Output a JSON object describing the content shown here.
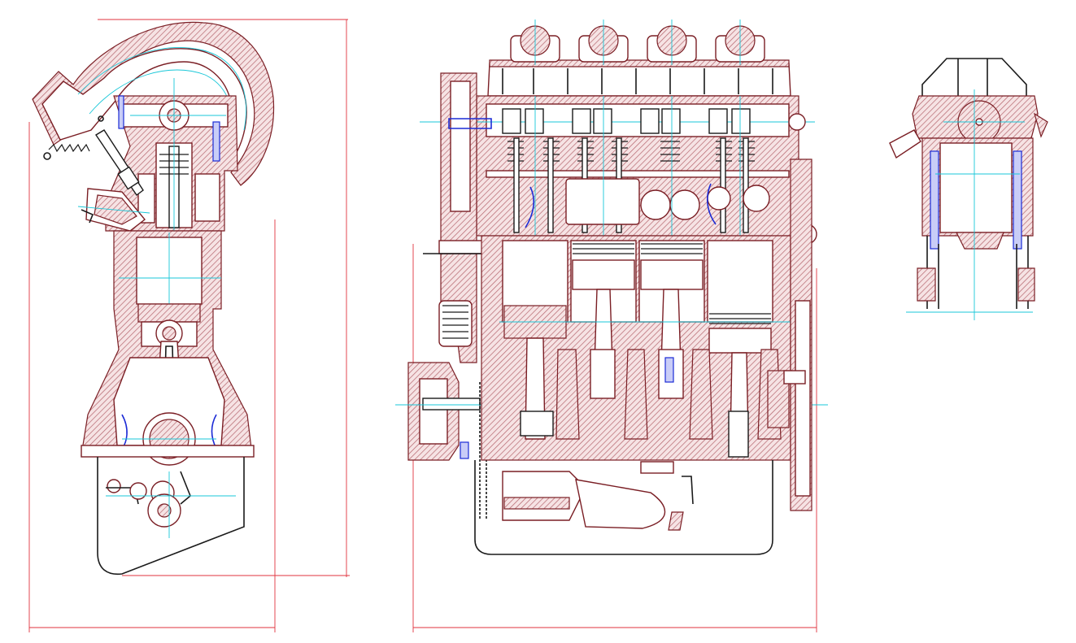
{
  "drawing": {
    "views": [
      "side-section",
      "front-section",
      "rear-view"
    ]
  },
  "dimensions": {
    "height_label": "",
    "side_width_label": "",
    "front_width_label": "",
    "bore_label": "",
    "stroke_label": ""
  },
  "colors": {
    "outline": "#7a1e24",
    "hatch": "#b4646c",
    "centerline": "#18c7d8",
    "dimension": "#e0333d",
    "blue_parts": "#1c2bd6"
  }
}
